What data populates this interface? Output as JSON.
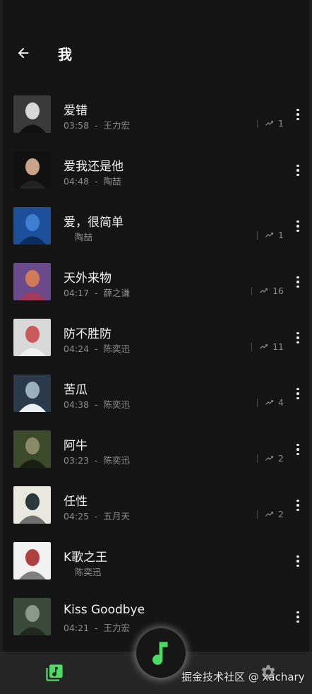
{
  "header": {
    "title": "我"
  },
  "songs": [
    {
      "title": "爱错",
      "duration": "03:58",
      "sep": "-",
      "artist": "王力宏",
      "plays": "1"
    },
    {
      "title": "爱我还是他",
      "duration": "04:48",
      "sep": "-",
      "artist": "陶喆",
      "plays": ""
    },
    {
      "title": "爱，很简单",
      "duration": "",
      "sep": "",
      "artist": "陶喆",
      "plays": "1"
    },
    {
      "title": "天外来物",
      "duration": "04:17",
      "sep": "-",
      "artist": "薛之谦",
      "plays": "16"
    },
    {
      "title": "防不胜防",
      "duration": "04:24",
      "sep": "-",
      "artist": "陈奕迅",
      "plays": "11"
    },
    {
      "title": "苦瓜",
      "duration": "04:38",
      "sep": "-",
      "artist": "陈奕迅",
      "plays": "4"
    },
    {
      "title": "阿牛",
      "duration": "03:23",
      "sep": "-",
      "artist": "陈奕迅",
      "plays": "2"
    },
    {
      "title": "任性",
      "duration": "04:25",
      "sep": "-",
      "artist": "五月天",
      "plays": "2"
    },
    {
      "title": "K歌之王",
      "duration": "",
      "sep": "",
      "artist": "陈奕迅",
      "plays": ""
    },
    {
      "title": "Kiss Goodbye",
      "duration": "04:21",
      "sep": "-",
      "artist": "王力宏",
      "plays": ""
    }
  ],
  "watermark": "掘金技术社区 @ xachary",
  "icons": {
    "back": "arrow-left-icon",
    "more": "more-vertical-icon",
    "trend": "trending-up-icon",
    "library": "music-library-icon",
    "player": "music-note-icon",
    "settings": "gear-icon"
  },
  "colors": {
    "accent": "#4cd964",
    "background": "#141414",
    "bar": "#252525"
  }
}
